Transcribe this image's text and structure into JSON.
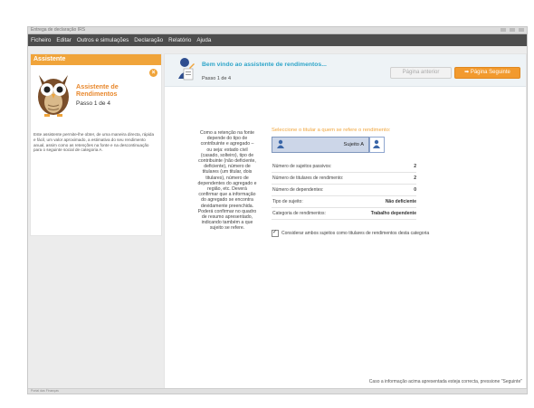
{
  "window": {
    "title": "Entrega de declaração IRS"
  },
  "menu": [
    "Ficheiro",
    "Editar",
    "Outros e simulações",
    "Declaração",
    "Relatório",
    "Ajuda"
  ],
  "assistant": {
    "header": "Assistente",
    "title": "Assistente de Rendimentos",
    "step": "Passo 1 de 4",
    "description": "Este assistente permite-lhe obter, de uma maneira directa, rápida e fácil, um valor aproximado, a estimativa do seu rendimento anual, assim como as retenções na fonte e na descontinuação para o seguinte social de categoria A."
  },
  "banner": {
    "welcome": "Bem vindo ao assistente de rendimentos...",
    "step": "Passo 1 de 4",
    "prev_label": "Página anterior",
    "next_label": "Página Seguinte"
  },
  "info_text": "Como a retenção na fonte depende do tipo de contribuinte e agregado – ou seja: estado civil (casado, solteiro), tipo de contribuinte (não deficiente, deficiente), número de titulares (um titular, dois titulares), número de dependentes do agregado e região, etc. Deverá confirmar que a informação do agregado se encontra devidamente preenchida. Poderá confirmar no quadro de resumo apresentado, indicando também a que sujeito se refere.",
  "selection": {
    "title": "Seleccione o titular a quem se refere o rendimento:",
    "subject_label": "Sujeito A"
  },
  "summary": [
    {
      "key": "Número de sujeitos passivos:",
      "value": "2"
    },
    {
      "key": "Número de titulares de rendimento:",
      "value": "2"
    },
    {
      "key": "Número de dependentes:",
      "value": "0"
    },
    {
      "key": "Tipo de sujeito:",
      "value": "Não deficiente"
    },
    {
      "key": "Categoria de rendimentos:",
      "value": "Trabalho dependente"
    }
  ],
  "checkbox_label": "Considerar ambos sujeitos como titulares de rendimentos desta categoria",
  "footer_note": "Caso a informação acima apresentada esteja correcta, pressione \"Seguinte\"",
  "status": "Portal das Finanças",
  "colors": {
    "accent": "#f0a43a",
    "link": "#2fa5c9",
    "menubar": "#4d4d4d"
  }
}
